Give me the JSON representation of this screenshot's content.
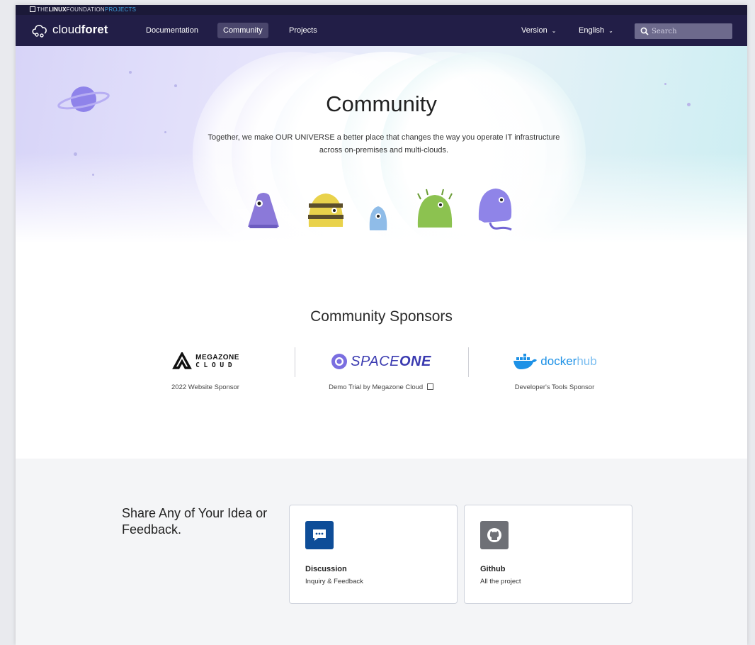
{
  "linux_foundation": {
    "prefix": "THE",
    "bold": "LINUX",
    "middle": "FOUNDATION",
    "suffix": "PROJECTS"
  },
  "brand": {
    "name_light": "cloud",
    "name_bold": "foret"
  },
  "nav": {
    "items": [
      {
        "label": "Documentation"
      },
      {
        "label": "Community"
      },
      {
        "label": "Projects"
      }
    ],
    "version_label": "Version",
    "language_label": "English",
    "search_placeholder": "Search"
  },
  "hero": {
    "title": "Community",
    "subtitle": "Together, we make OUR UNIVERSE a better place that changes the way you operate IT infrastructure across on-premises and multi-clouds."
  },
  "sponsors": {
    "title": "Community Sponsors",
    "items": [
      {
        "logo_top": "MEGAZONE",
        "logo_bottom": "C L O U D",
        "caption": "2022 Website Sponsor"
      },
      {
        "logo_light": "SPACE",
        "logo_bold": "ONE",
        "caption": "Demo Trial by Megazone Cloud"
      },
      {
        "logo_light": "docker",
        "logo_accent": "hub",
        "caption": "Developer's Tools Sponsor"
      }
    ]
  },
  "feedback": {
    "title": "Share Any of Your Idea or Feedback.",
    "cards": [
      {
        "title": "Discussion",
        "subtitle": "Inquiry & Feedback",
        "icon": "chat-bubble-icon",
        "color": "#0e4d98"
      },
      {
        "title": "Github",
        "subtitle": "All the project",
        "icon": "github-icon",
        "color": "#6e7076"
      }
    ]
  },
  "colors": {
    "nav_bg": "#221e47",
    "accent_purple": "#8a7fe6",
    "docker_blue": "#1d91e6"
  }
}
